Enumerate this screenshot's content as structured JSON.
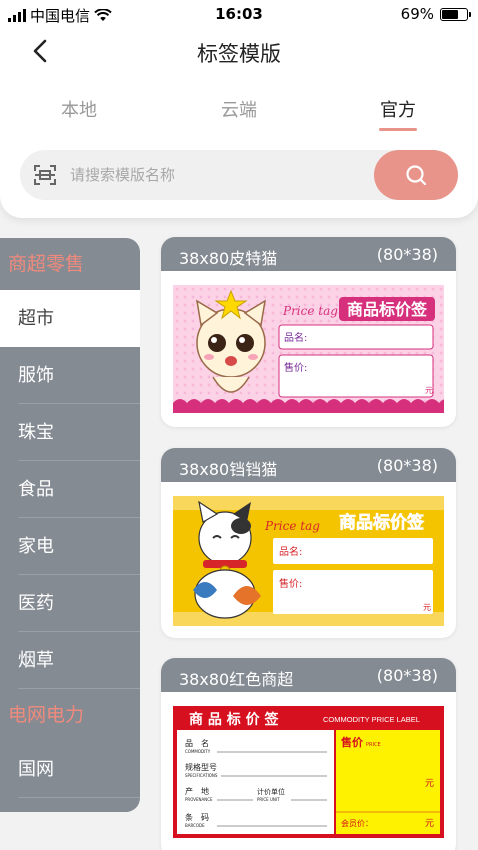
{
  "status": {
    "carrier": "中国电信",
    "time": "16:03",
    "battery": "69%",
    "battery_level": 0.69
  },
  "nav": {
    "title": "标签模版"
  },
  "tabs": [
    {
      "label": "本地"
    },
    {
      "label": "云端"
    },
    {
      "label": "官方"
    }
  ],
  "search": {
    "placeholder": "请搜索模版名称"
  },
  "sidebar": [
    {
      "label": "商超零售",
      "type": "group"
    },
    {
      "label": "超市",
      "type": "item",
      "active": true
    },
    {
      "label": "服饰",
      "type": "item"
    },
    {
      "label": "珠宝",
      "type": "item"
    },
    {
      "label": "食品",
      "type": "item"
    },
    {
      "label": "家电",
      "type": "item"
    },
    {
      "label": "医药",
      "type": "item"
    },
    {
      "label": "烟草",
      "type": "item"
    },
    {
      "label": "电网电力",
      "type": "group"
    },
    {
      "label": "国网",
      "type": "item"
    }
  ],
  "cards": [
    {
      "name": "38x80皮特猫",
      "size": "(80*38)",
      "label": {
        "price_tag": "Price tag",
        "title": "商品标价签",
        "field1": "品名:",
        "field2": "售价:",
        "unit": "元"
      }
    },
    {
      "name": "38x80铛铛猫",
      "size": "(80*38)",
      "label": {
        "price_tag": "Price tag",
        "title": "商品标价签",
        "field1": "品名:",
        "field2": "售价:",
        "unit": "元"
      }
    },
    {
      "name": "38x80红色商超",
      "size": "(80*38)",
      "label": {
        "title": "商 品 标 价 签",
        "title_en": "COMMODITY PRICE LABEL",
        "row1": "品　名",
        "row1_en": "COMMODITY",
        "row2": "规格型号",
        "row2_en": "SPECIFICATIONS",
        "row3a": "产　地",
        "row3a_en": "PROVENANCE",
        "row3b": "计价单位",
        "row3b_en": "PRICE UNIT",
        "row4": "条　码",
        "row4_en": "BARCODE",
        "price": "售价",
        "price_en": "PRICE",
        "unit": "元",
        "member": "会员价：",
        "member_unit": "元"
      }
    }
  ],
  "colors": {
    "accent": "#e8948a",
    "sidebar": "#858b93",
    "group_text": "#f08a7c"
  }
}
